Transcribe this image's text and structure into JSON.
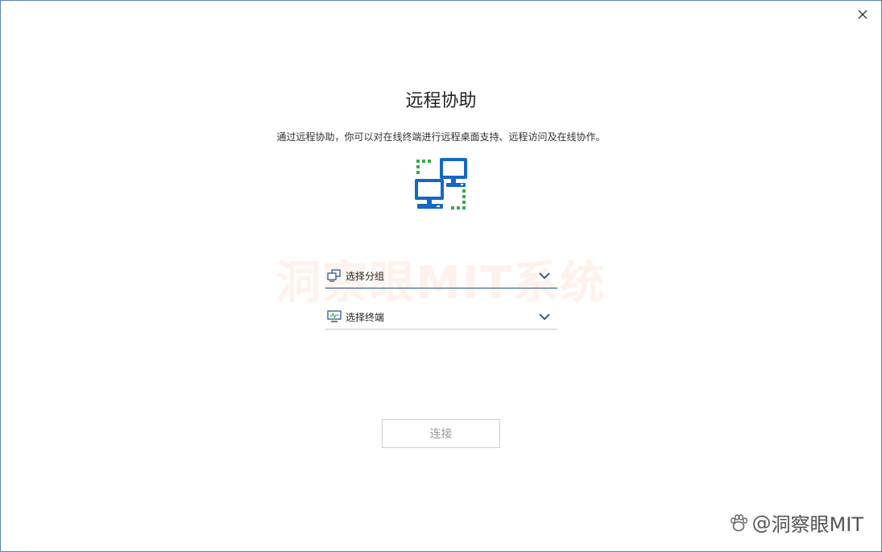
{
  "window": {
    "title": "远程协助",
    "description": "通过远程协助，你可以对在线终端进行远程桌面支持、远程访问及在线协作。"
  },
  "icons": {
    "close": "close-icon",
    "hero": "remote-computers-icon",
    "group": "group-computers-icon",
    "terminal": "monitor-icon",
    "chevron": "chevron-down-icon"
  },
  "group_select": {
    "placeholder": "选择分组"
  },
  "terminal_select": {
    "placeholder": "选择终端"
  },
  "actions": {
    "connect_label": "连接"
  },
  "watermarks": {
    "center": "洞察眼MIT系统",
    "footer_prefix": "@",
    "footer_text": "洞察眼MIT"
  },
  "colors": {
    "accent_blue": "#1668c0",
    "accent_green": "#3aa94a",
    "underline_active": "#1f4f86"
  }
}
